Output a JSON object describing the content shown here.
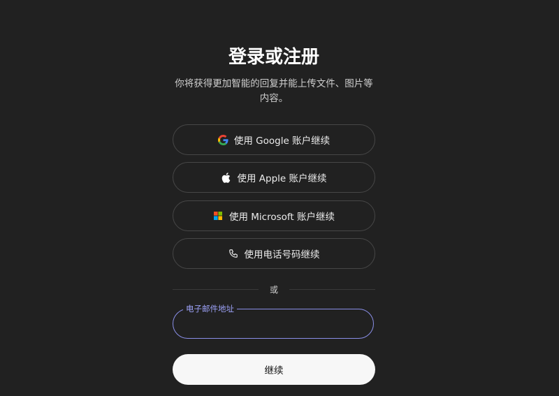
{
  "title": "登录或注册",
  "subtitle": "你将获得更加智能的回复并能上传文件、图片等内容。",
  "buttons": {
    "google": "使用 Google 账户继续",
    "apple": "使用 Apple 账户继续",
    "microsoft": "使用 Microsoft 账户继续",
    "phone": "使用电话号码继续"
  },
  "divider": "或",
  "email": {
    "label": "电子邮件地址",
    "value": "",
    "placeholder": ""
  },
  "continue": "继续",
  "colors": {
    "background": "#212121",
    "focus_border": "#8a8fe8",
    "continue_bg": "#f7f7f7"
  }
}
